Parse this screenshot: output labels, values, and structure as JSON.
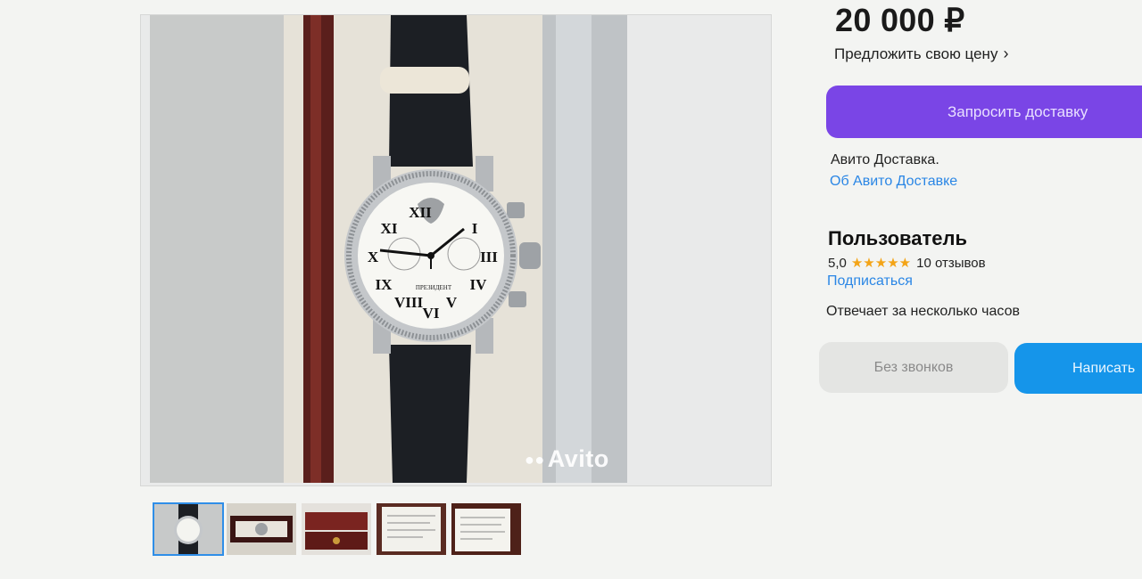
{
  "listing": {
    "price": "20 000 ₽",
    "offer_price_label": "Предложить свою цену",
    "watermark": "Avito",
    "thumbnails": [
      "watch-photo",
      "watch-in-case",
      "red-box",
      "document-1",
      "document-2"
    ]
  },
  "delivery": {
    "request_button": "Запросить доставку",
    "service_label": "Авито Доставка.",
    "about_link": "Об Авито Доставке"
  },
  "seller": {
    "name": "Пользователь",
    "rating": "5,0",
    "stars": "★★★★★",
    "reviews": "10 отзывов",
    "subscribe_link": "Подписаться",
    "response_time": "Отвечает за несколько часов"
  },
  "contact": {
    "no_calls_button": "Без звонков",
    "write_button": "Написать"
  },
  "colors": {
    "accent_purple": "#7a45e6",
    "accent_blue": "#1595ea",
    "link_blue": "#2a86e5",
    "star": "#f3a417"
  }
}
